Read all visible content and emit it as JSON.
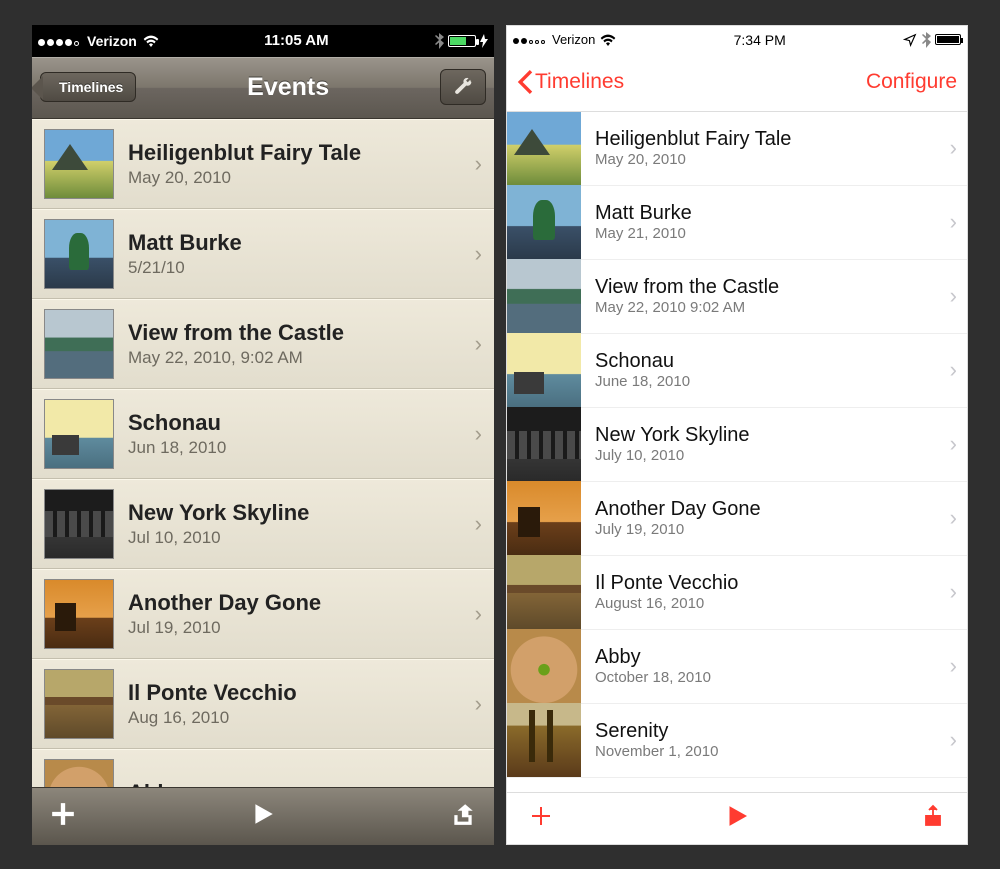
{
  "left": {
    "status": {
      "carrier": "Verizon",
      "time": "11:05 AM",
      "signal_dots": 5,
      "signal_filled": 4
    },
    "nav": {
      "back_label": "Timelines",
      "title": "Events"
    },
    "events": [
      {
        "title": "Heiligenblut Fairy Tale",
        "subtitle": "May 20, 2010",
        "thumb": "th-mountain"
      },
      {
        "title": "Matt Burke",
        "subtitle": "5/21/10",
        "thumb": "th-photographer"
      },
      {
        "title": "View from the Castle",
        "subtitle": "May 22, 2010, 9:02 AM",
        "thumb": "th-lake"
      },
      {
        "title": "Schonau",
        "subtitle": "Jun 18, 2010",
        "thumb": "th-boat1"
      },
      {
        "title": "New York Skyline",
        "subtitle": "Jul 10, 2010",
        "thumb": "th-skyline"
      },
      {
        "title": "Another Day Gone",
        "subtitle": "Jul 19, 2010",
        "thumb": "th-sunset"
      },
      {
        "title": "Il Ponte Vecchio",
        "subtitle": "Aug 16, 2010",
        "thumb": "th-bridge"
      },
      {
        "title": "Abby",
        "subtitle": "",
        "thumb": "th-cat"
      }
    ]
  },
  "right": {
    "status": {
      "carrier": "Verizon",
      "time": "7:34 PM",
      "signal_dots": 5,
      "signal_filled": 2
    },
    "nav": {
      "back_label": "Timelines",
      "configure_label": "Configure"
    },
    "events": [
      {
        "title": "Heiligenblut Fairy Tale",
        "subtitle": "May 20, 2010",
        "thumb": "th-mountain"
      },
      {
        "title": "Matt Burke",
        "subtitle": "May 21, 2010",
        "thumb": "th-photographer"
      },
      {
        "title": "View from the Castle",
        "subtitle": "May 22, 2010 9:02 AM",
        "thumb": "th-lake"
      },
      {
        "title": "Schonau",
        "subtitle": "June 18, 2010",
        "thumb": "th-boat1"
      },
      {
        "title": "New York Skyline",
        "subtitle": "July 10, 2010",
        "thumb": "th-skyline"
      },
      {
        "title": "Another Day Gone",
        "subtitle": "July 19, 2010",
        "thumb": "th-sunset"
      },
      {
        "title": "Il Ponte Vecchio",
        "subtitle": "August 16, 2010",
        "thumb": "th-bridge"
      },
      {
        "title": "Abby",
        "subtitle": "October 18, 2010",
        "thumb": "th-cat"
      },
      {
        "title": "Serenity",
        "subtitle": "November 1, 2010",
        "thumb": "th-trees"
      }
    ]
  }
}
